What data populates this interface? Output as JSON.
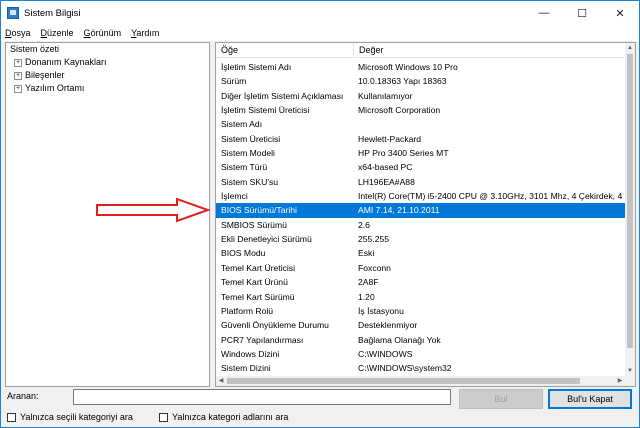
{
  "window": {
    "title": "Sistem Bilgisi",
    "controls": {
      "minimize": "—",
      "maximize": "☐",
      "close": "✕"
    }
  },
  "menu": [
    {
      "label": "Dosya"
    },
    {
      "label": "Düzenle"
    },
    {
      "label": "Görünüm"
    },
    {
      "label": "Yardım"
    }
  ],
  "tree": {
    "root": "Sistem özeti",
    "children": [
      {
        "label": "Donanım Kaynakları",
        "expander": "+"
      },
      {
        "label": "Bileşenler",
        "expander": "+"
      },
      {
        "label": "Yazılım Ortamı",
        "expander": "+"
      }
    ]
  },
  "list": {
    "columns": {
      "key": "Öğe",
      "value": "Değer"
    },
    "rows": [
      {
        "k": "İşletim Sistemi Adı",
        "v": "Microsoft Windows 10 Pro"
      },
      {
        "k": "Sürüm",
        "v": "10.0.18363 Yapı 18363"
      },
      {
        "k": "Diğer İşletim Sistemi Açıklaması",
        "v": "Kullanılamıyor"
      },
      {
        "k": "İşletim Sistemi Üreticisi",
        "v": "Microsoft Corporation"
      },
      {
        "k": "Sistem Adı",
        "v": ""
      },
      {
        "k": "Sistem Üreticisi",
        "v": "Hewlett-Packard"
      },
      {
        "k": "Sistem Modeli",
        "v": "HP Pro 3400 Series MT"
      },
      {
        "k": "Sistem Türü",
        "v": "x64-based PC"
      },
      {
        "k": "Sistem SKU'su",
        "v": "LH196EA#A88"
      },
      {
        "k": "İşlemci",
        "v": "Intel(R) Core(TM) i5-2400 CPU @ 3.10GHz, 3101 Mhz, 4 Çekirdek, 4"
      },
      {
        "k": "BIOS Sürümü/Tarihi",
        "v": "AMI 7.14, 21.10.2011",
        "selected": true
      },
      {
        "k": "SMBIOS Sürümü",
        "v": "2.6"
      },
      {
        "k": "Ekli Denetleyici Sürümü",
        "v": "255.255"
      },
      {
        "k": "BIOS Modu",
        "v": "Eski"
      },
      {
        "k": "Temel Kart Üreticisi",
        "v": "Foxconn"
      },
      {
        "k": "Temel Kart Ürünü",
        "v": "2A8F"
      },
      {
        "k": "Temel Kart Sürümü",
        "v": "1.20"
      },
      {
        "k": "Platform Rolü",
        "v": "İş İstasyonu"
      },
      {
        "k": "Güvenli Önyükleme Durumu",
        "v": "Desteklenmiyor"
      },
      {
        "k": "PCR7 Yapılandırması",
        "v": "Bağlama Olanağı Yok"
      },
      {
        "k": "Windows Dizini",
        "v": "C:\\WINDOWS"
      },
      {
        "k": "Sistem Dizini",
        "v": "C:\\WINDOWS\\system32"
      }
    ]
  },
  "search": {
    "label": "Aranan:",
    "value": "",
    "find_button": "Bul",
    "close_button": "Bul'u Kapat",
    "option_selected_category": "Yalnızca seçili kategoriyi ara",
    "option_category_names": "Yalnızca kategori adlarını ara"
  },
  "colors": {
    "selection": "#0078d7",
    "annotation_arrow": "#e02020"
  }
}
